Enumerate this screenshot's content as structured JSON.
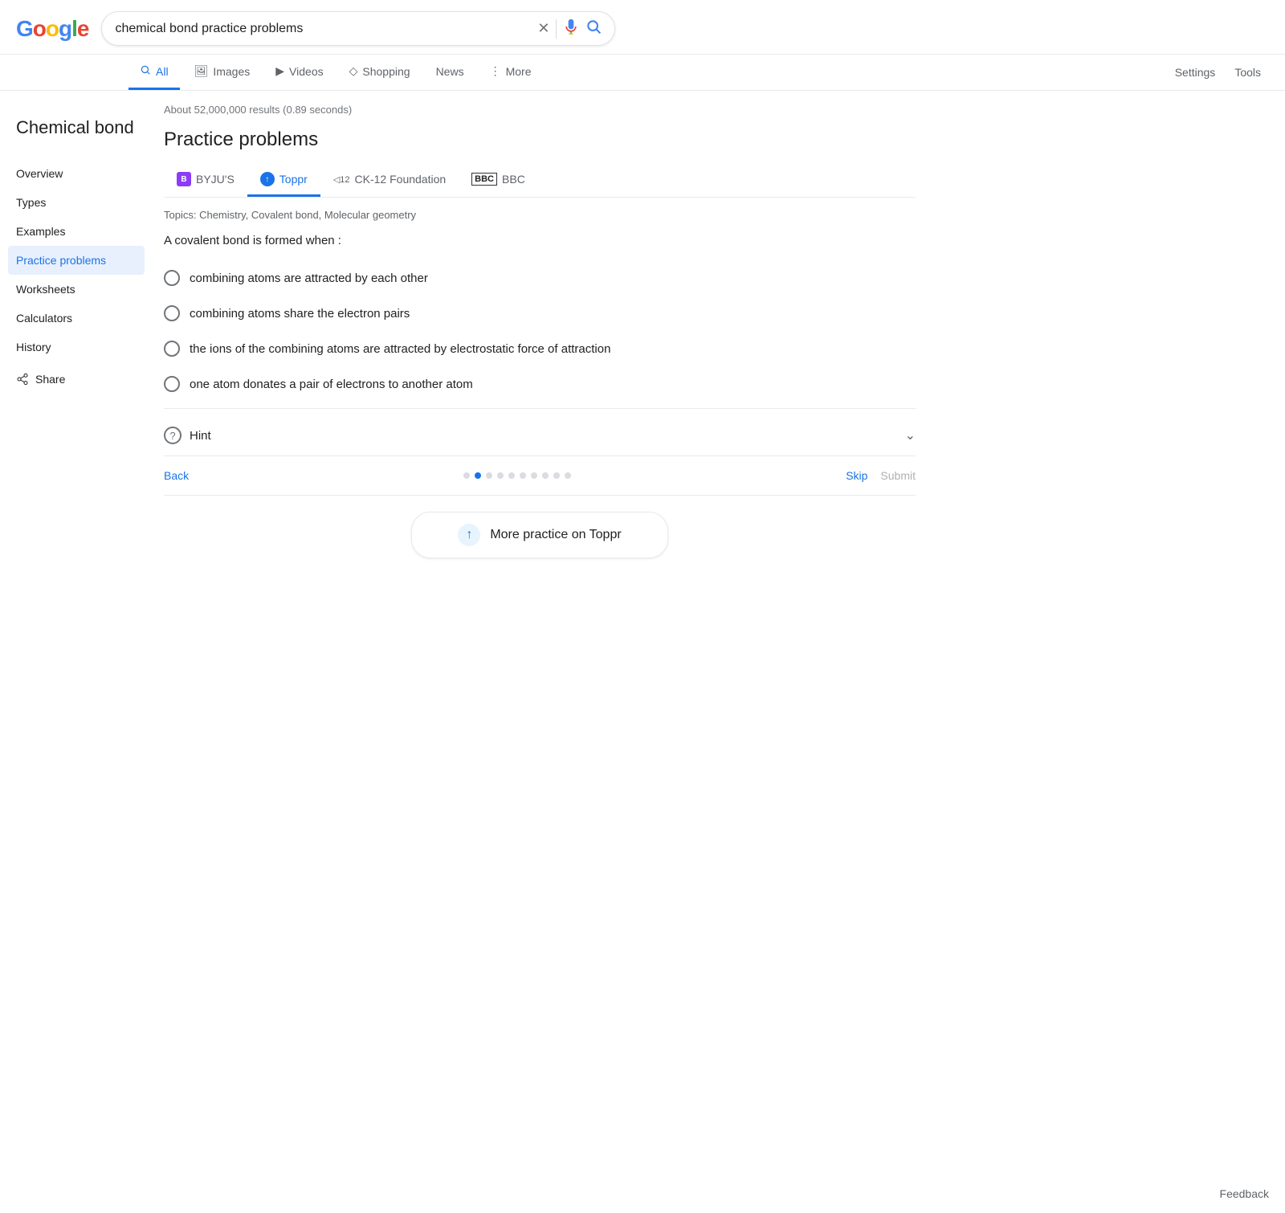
{
  "header": {
    "search_query": "chemical bond practice problems",
    "clear_label": "✕",
    "mic_label": "🎙",
    "search_label": "🔍"
  },
  "tabs": {
    "items": [
      {
        "id": "all",
        "label": "All",
        "icon": "🔍",
        "active": true
      },
      {
        "id": "images",
        "label": "Images",
        "icon": "🖼",
        "active": false
      },
      {
        "id": "videos",
        "label": "Videos",
        "icon": "▶",
        "active": false
      },
      {
        "id": "shopping",
        "label": "Shopping",
        "icon": "◇",
        "active": false
      },
      {
        "id": "news",
        "label": "News",
        "icon": "",
        "active": false
      },
      {
        "id": "more",
        "label": "More",
        "icon": "⋮",
        "active": false
      }
    ],
    "settings": "Settings",
    "tools": "Tools"
  },
  "results_count": "About 52,000,000 results (0.89 seconds)",
  "sidebar": {
    "title": "Chemical bond",
    "items": [
      {
        "id": "overview",
        "label": "Overview",
        "active": false
      },
      {
        "id": "types",
        "label": "Types",
        "active": false
      },
      {
        "id": "examples",
        "label": "Examples",
        "active": false
      },
      {
        "id": "practice-problems",
        "label": "Practice problems",
        "active": true
      },
      {
        "id": "worksheets",
        "label": "Worksheets",
        "active": false
      },
      {
        "id": "calculators",
        "label": "Calculators",
        "active": false
      },
      {
        "id": "history",
        "label": "History",
        "active": false
      }
    ],
    "share": "Share"
  },
  "section": {
    "title": "Practice problems",
    "sources": [
      {
        "id": "byjus",
        "label": "BYJU'S",
        "logo_type": "byjus",
        "active": false
      },
      {
        "id": "toppr",
        "label": "Toppr",
        "logo_type": "toppr",
        "active": true
      },
      {
        "id": "ck12",
        "label": "CK-12 Foundation",
        "logo_type": "ck12",
        "active": false
      },
      {
        "id": "bbc",
        "label": "BBC",
        "logo_type": "bbc",
        "active": false
      }
    ],
    "topics": "Topics: Chemistry, Covalent bond, Molecular geometry",
    "question": "A covalent bond is formed when :",
    "options": [
      {
        "id": "opt1",
        "label": "combining atoms are attracted by each other",
        "selected": false
      },
      {
        "id": "opt2",
        "label": "combining atoms share the electron pairs",
        "selected": false
      },
      {
        "id": "opt3",
        "label": "the ions of the combining atoms are attracted by electrostatic force of attraction",
        "selected": false
      },
      {
        "id": "opt4",
        "label": "one atom donates a pair of electrons to another atom",
        "selected": false
      }
    ],
    "hint_label": "Hint",
    "hint_icon": "?",
    "nav": {
      "back": "Back",
      "skip": "Skip",
      "submit": "Submit",
      "dots_count": 10,
      "active_dot": 1
    },
    "more_practice_label": "More practice on Toppr"
  },
  "feedback": "Feedback"
}
